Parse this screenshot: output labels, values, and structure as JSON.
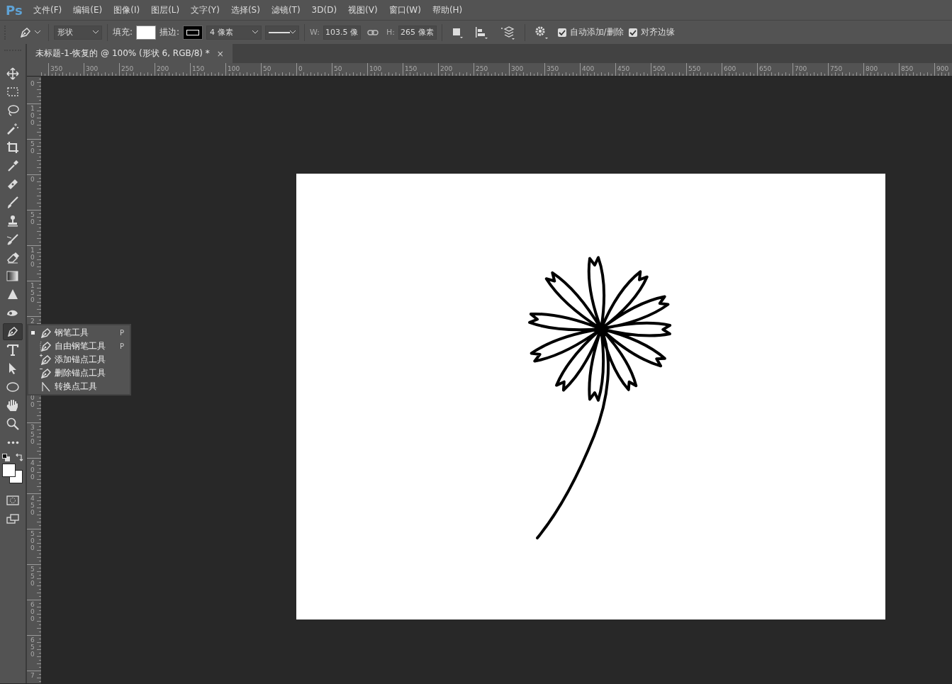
{
  "app": {
    "logo": "Ps"
  },
  "menu": [
    "文件(F)",
    "编辑(E)",
    "图像(I)",
    "图层(L)",
    "文字(Y)",
    "选择(S)",
    "滤镜(T)",
    "3D(D)",
    "视图(V)",
    "窗口(W)",
    "帮助(H)"
  ],
  "options_bar": {
    "mode": "形状",
    "fill_label": "填充:",
    "stroke_label": "描边:",
    "stroke_width": "4 像素",
    "w_label": "W:",
    "w_value": "103.5 像",
    "h_label": "H:",
    "h_value": "265 像素",
    "checkboxes": [
      {
        "label": "自动添加/删除",
        "checked": true
      },
      {
        "label": "对齐边缘",
        "checked": true
      }
    ]
  },
  "document_tab": {
    "title": "未标题-1-恢复的 @ 100% (形状 6, RGB/8) *",
    "close": "×",
    "selected": true
  },
  "ruler_h": [
    "350",
    "300",
    "250",
    "200",
    "150",
    "100",
    "50",
    "0",
    "50",
    "100",
    "150",
    "200",
    "250",
    "300",
    "350",
    "400",
    "450",
    "500",
    "550",
    "600",
    "650",
    "700",
    "750",
    "800",
    "850",
    "900"
  ],
  "ruler_v": [
    "0",
    "100",
    "50",
    "0",
    "50",
    "100",
    "150",
    "2",
    "00",
    "350",
    "400",
    "450",
    "500",
    "550",
    "600",
    "650",
    "7"
  ],
  "tools": [
    {
      "kind": "move",
      "selected": false
    },
    {
      "kind": "marquee",
      "selected": false
    },
    {
      "kind": "lasso",
      "selected": false
    },
    {
      "kind": "wand",
      "selected": false
    },
    {
      "kind": "crop",
      "selected": false
    },
    {
      "kind": "eyedropper",
      "selected": false
    },
    {
      "kind": "bandage",
      "selected": false
    },
    {
      "kind": "brush",
      "selected": false
    },
    {
      "kind": "stamp",
      "selected": false
    },
    {
      "kind": "history",
      "selected": false
    },
    {
      "kind": "eraser",
      "selected": false
    },
    {
      "kind": "gradient",
      "selected": false
    },
    {
      "kind": "blur",
      "selected": false
    },
    {
      "kind": "dodge",
      "selected": false
    },
    {
      "kind": "pen",
      "selected": true
    },
    {
      "kind": "type",
      "selected": false
    },
    {
      "kind": "select",
      "selected": false
    },
    {
      "kind": "ellipse",
      "selected": false
    },
    {
      "kind": "hand",
      "selected": false
    },
    {
      "kind": "zoom",
      "selected": false
    },
    {
      "kind": "more",
      "selected": false
    }
  ],
  "flyout": [
    {
      "label": "钢笔工具",
      "shortcut": "P",
      "selected": true,
      "kind": "pen"
    },
    {
      "label": "自由钢笔工具",
      "shortcut": "P",
      "selected": false,
      "kind": "freeform"
    },
    {
      "label": "添加锚点工具",
      "selected": false,
      "kind": "add"
    },
    {
      "label": "删除锚点工具",
      "selected": false,
      "kind": "delete"
    },
    {
      "label": "转换点工具",
      "selected": false,
      "kind": "convert"
    }
  ]
}
